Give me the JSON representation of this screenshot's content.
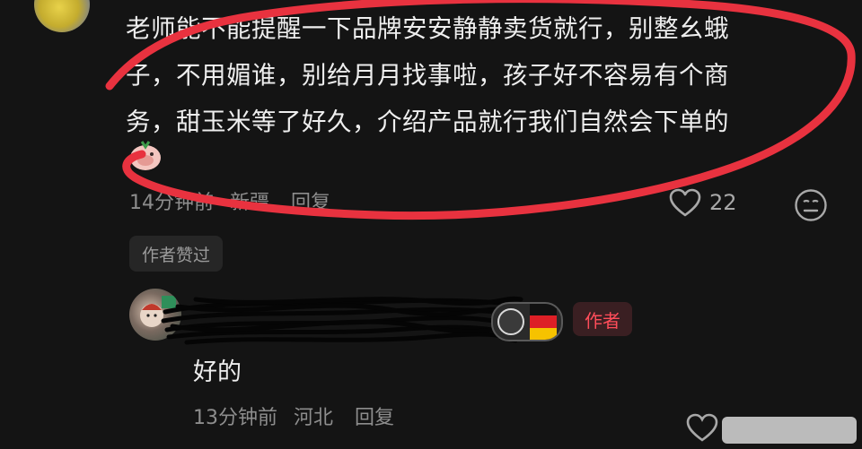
{
  "comment": {
    "lines": [
      "老师能不能提醒一下品牌安安静静卖货就行，别整幺蛾",
      "子，不用媚谁，别给月月找事啦，孩子好不容易有个商",
      "务，甜玉米等了好久，介绍产品就行我们自然会下单的"
    ],
    "time": "14分钟前",
    "location": "新疆",
    "reply_label": "回复",
    "like_count": "22",
    "author_liked_label": "作者赞过"
  },
  "reply": {
    "author_tag": "作者",
    "text": "好的",
    "time": "13分钟前",
    "location": "河北",
    "reply_label": "回复"
  },
  "colors": {
    "background": "#141414",
    "annotation_red": "#e8323f",
    "author_tag_red": "#ff4d5a",
    "meta_gray": "#8d8d8d"
  },
  "icons": {
    "like": "heart-outline-icon",
    "dislike": "meh-face-icon",
    "flag": "germany-flag-icon"
  }
}
